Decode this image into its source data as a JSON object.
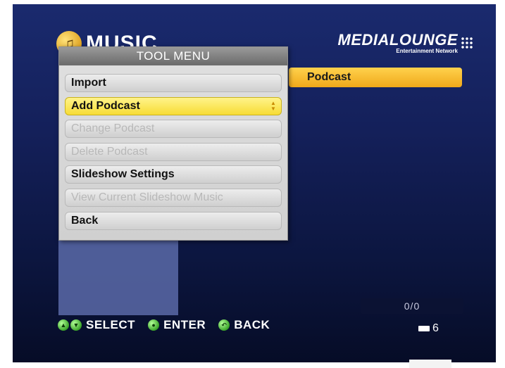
{
  "header": {
    "section_title": "MUSIC",
    "music_icon": "music-note-icon",
    "brand_name": "MEDIALOUNGE",
    "brand_subtitle": "Entertainment Network"
  },
  "list": {
    "highlighted_item": "Podcast"
  },
  "tool_menu": {
    "title": "TOOL MENU",
    "items": [
      {
        "label": "Import",
        "state": "enabled"
      },
      {
        "label": "Add Podcast",
        "state": "selected"
      },
      {
        "label": "Change Podcast",
        "state": "disabled"
      },
      {
        "label": "Delete Podcast",
        "state": "disabled"
      },
      {
        "label": "Slideshow Settings",
        "state": "enabled"
      },
      {
        "label": "View Current Slideshow Music",
        "state": "disabled"
      },
      {
        "label": "Back",
        "state": "enabled"
      }
    ]
  },
  "footer": {
    "select_label": "SELECT",
    "enter_label": "ENTER",
    "back_label": "BACK",
    "counter": "0/0",
    "battery_value": "6"
  },
  "colors": {
    "background_top": "#1a2a6e",
    "highlight": "#f7dc35",
    "podcast_bar": "#f0a81a"
  }
}
